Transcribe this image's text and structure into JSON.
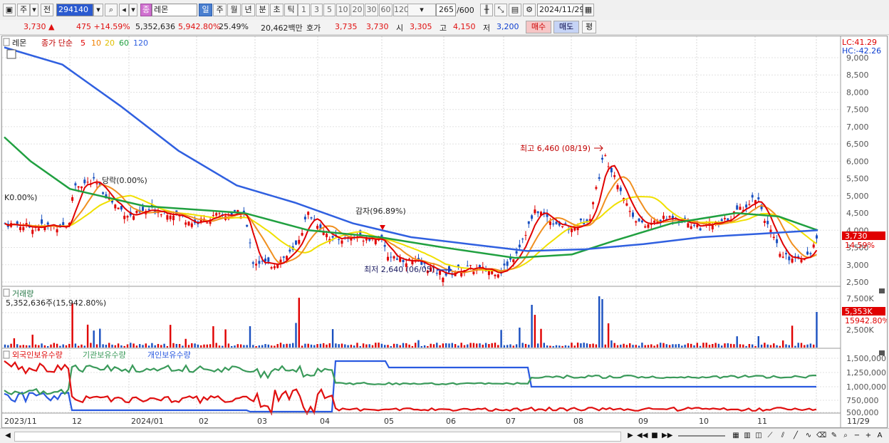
{
  "toolbar": {
    "period_type": "주",
    "prev_label": "전",
    "code": "294140",
    "name_badge": "종",
    "stock_name": "레몬",
    "tabs": [
      "일",
      "주",
      "월",
      "년",
      "분",
      "초",
      "틱"
    ],
    "active_tab": "일",
    "intervals": [
      "1",
      "3",
      "5",
      "10",
      "20",
      "30",
      "60",
      "120"
    ],
    "count": "265",
    "count_max": "/600",
    "date": "2024/11/29"
  },
  "info": {
    "price": "3,730",
    "change": "475 +14.59%",
    "volume": "5,352,636",
    "volume_ratio": "5,942.80%",
    "turnover": "25.49%",
    "amount": "20,462백만",
    "quote_label": "호가",
    "quote_ask": "3,735",
    "quote_bid": "3,730",
    "open_label": "시",
    "open": "3,305",
    "high_label": "고",
    "high": "4,150",
    "low_label": "저",
    "low": "3,200",
    "buy_label": "매수",
    "sell_label": "매도",
    "eval_label": "평"
  },
  "price_panel": {
    "stock_label": "레몬",
    "legend_prefix": "종가 단순",
    "ma_periods": [
      "5",
      "10",
      "20",
      "60",
      "120"
    ],
    "ma_colors": [
      "#e00000",
      "#f08000",
      "#f0d000",
      "#20a040",
      "#3060e0"
    ],
    "lc": "LC:41.29",
    "hc": "HC:-42.26",
    "last_price_tag": "3,730",
    "last_pct_tag": "14.59%",
    "annotations": {
      "high": "최고 6,460 (08/19)",
      "low": "최저 2,640 (06/05)",
      "capital_reduction": "감자(96.89%)",
      "ex_rights": "당락(0.00%)",
      "left_edge": "K0.00%)"
    },
    "y_ticks": [
      "9,000",
      "8,500",
      "8,000",
      "7,500",
      "7,000",
      "6,500",
      "6,000",
      "5,500",
      "5,000",
      "4,500",
      "4,000",
      "3,500",
      "3,000",
      "2,500"
    ]
  },
  "volume_panel": {
    "title": "거래량",
    "value": "5,352,636주(15,942.80%)",
    "last_tag": "5,353K",
    "last_pct_tag": "15942.80%",
    "y_ticks": [
      "7,500K",
      "5,000K",
      "2,500K"
    ]
  },
  "holder_panel": {
    "legend": [
      "외국인보유수량",
      "기관보유수량",
      "개인보유수량"
    ],
    "colors": [
      "#e01010",
      "#3a9a5a",
      "#2a5ae0"
    ],
    "y_ticks": [
      "1,500,000",
      "1,250,000",
      "1,000,000",
      "750,000",
      "500,000"
    ]
  },
  "x_axis": {
    "labels": [
      "2023/11",
      "12",
      "2024/01",
      "02",
      "03",
      "04",
      "05",
      "06",
      "07",
      "08",
      "09",
      "10",
      "11",
      "11/29"
    ]
  },
  "chart_data": {
    "type": "line",
    "title": "레몬 종가 단순 5 10 20 60 120",
    "x": [
      "2023/11",
      "12",
      "2024/01",
      "02",
      "03",
      "04",
      "05",
      "06",
      "07",
      "08",
      "09",
      "10",
      "11",
      "11/29"
    ],
    "series": [
      {
        "name": "종가",
        "values": [
          4200,
          4100,
          5400,
          4500,
          4300,
          4400,
          3000,
          4500,
          3700,
          2640,
          2900,
          4300,
          6460,
          4400,
          4200,
          4300,
          5200,
          3200,
          3730
        ]
      },
      {
        "name": "120",
        "values": [
          9300,
          8800,
          7600,
          6300,
          5300,
          4800,
          4200,
          3800,
          3600,
          3400,
          3450,
          3600,
          3800,
          3900,
          4000
        ]
      }
    ],
    "ylim": [
      2500,
      9000
    ]
  }
}
